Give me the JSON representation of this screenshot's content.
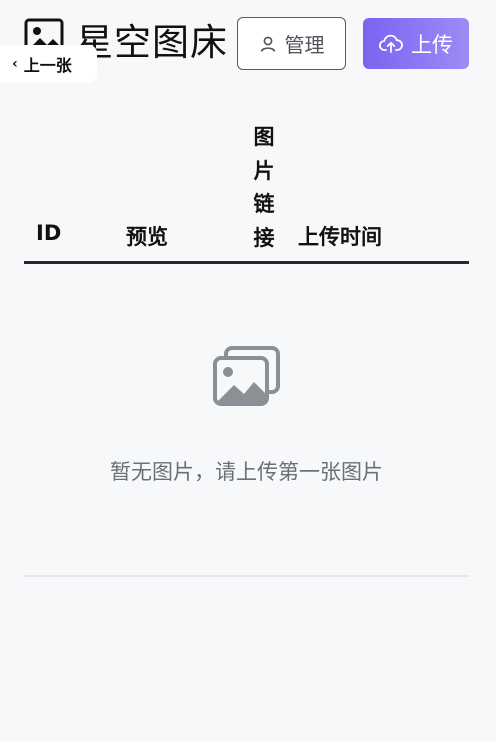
{
  "header": {
    "title": "星空图床",
    "logo_icon": "image-icon",
    "prev_label": "上一张",
    "prev_icon": "chevron-left-icon",
    "manage_label": "管理",
    "manage_icon": "user-icon",
    "upload_label": "上传",
    "upload_icon": "cloud-upload-icon",
    "accent": "#7b63f0"
  },
  "table": {
    "columns": {
      "id": "ID",
      "preview": "预览",
      "link": [
        "图",
        "片",
        "链",
        "接"
      ],
      "time": "上传时间"
    }
  },
  "empty": {
    "icon": "images-icon",
    "message": "暂无图片，请上传第一张图片"
  }
}
